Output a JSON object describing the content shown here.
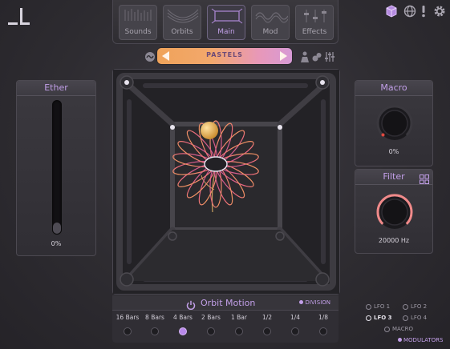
{
  "tabs": [
    {
      "label": "Sounds"
    },
    {
      "label": "Orbits"
    },
    {
      "label": "Main"
    },
    {
      "label": "Mod"
    },
    {
      "label": "Effects"
    }
  ],
  "active_tab": "Main",
  "preset": {
    "name": "PASTELS"
  },
  "ether": {
    "title": "Ether",
    "value": "0%",
    "level": 0
  },
  "macro": {
    "title": "Macro",
    "value": "0%"
  },
  "filter": {
    "title": "Filter",
    "value": "20000 Hz"
  },
  "orbit_motion": {
    "title": "Orbit Motion",
    "division_label": "DIVISION",
    "steps": [
      "16 Bars",
      "8 Bars",
      "4 Bars",
      "2 Bars",
      "1 Bar",
      "1/2",
      "1/4",
      "1/8"
    ],
    "selected": "4 Bars"
  },
  "modulators": {
    "items": [
      "LFO 1",
      "LFO 2",
      "LFO 3",
      "LFO 4",
      "MACRO"
    ],
    "selected": "LFO 3",
    "label": "MODULATORS"
  },
  "colors": {
    "accent": "#c29fe8",
    "preset_gradient_start": "#f0a35a",
    "preset_gradient_end": "#d79ad6",
    "knob_macro": "#e0483f",
    "knob_filter": "#f08a8a"
  },
  "icons": [
    "cube-icon",
    "globe-icon",
    "alert-icon",
    "gear-icon",
    "tilde-icon",
    "drops-icon",
    "sliders-icon",
    "power-icon",
    "grid-icon"
  ]
}
